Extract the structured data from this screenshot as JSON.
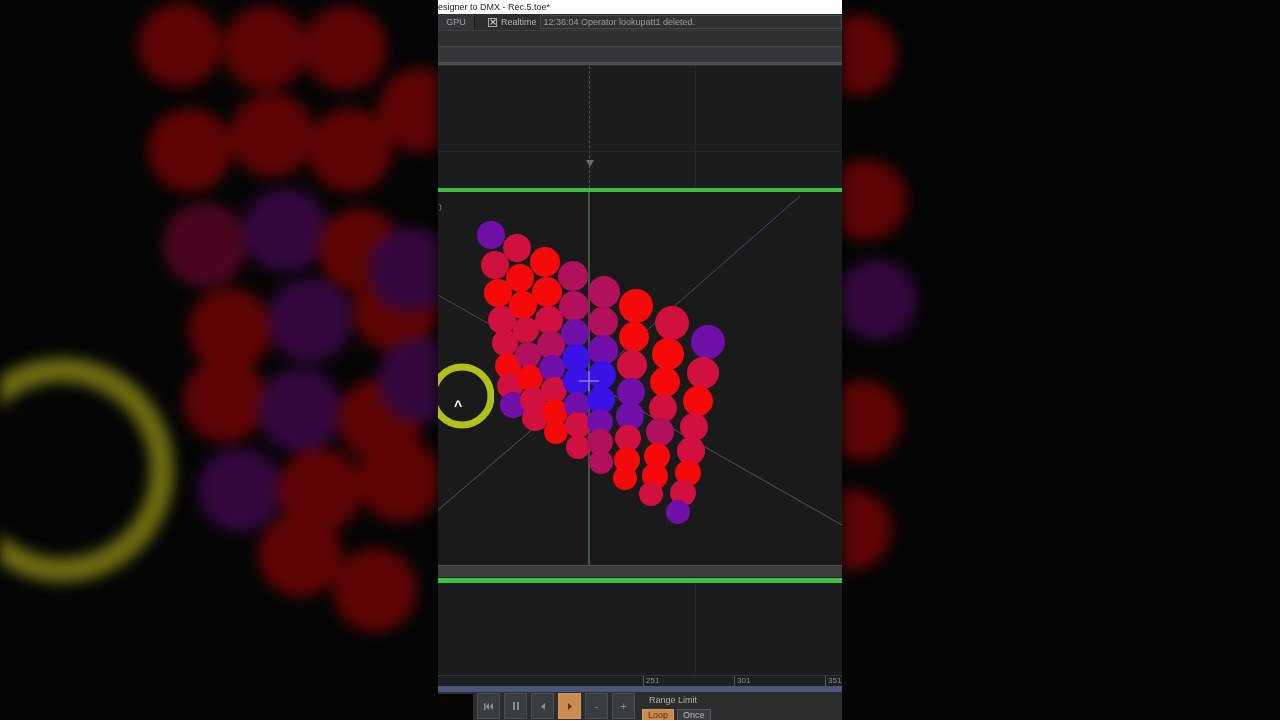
{
  "window": {
    "title": "esigner to DMX - Rec.5.toe*"
  },
  "toolbar": {
    "gpu_label": "GPU",
    "realtime": {
      "label": "Realtime",
      "checked": true
    },
    "message": "12:36:04 Operator lookupatt1 deleted."
  },
  "viewer": {
    "corner_text": ")",
    "ring_glyph": "^"
  },
  "timeline": {
    "ticks": [
      "251",
      "301",
      "351"
    ]
  },
  "transport": {
    "buttons": [
      {
        "kind": "skip-start",
        "selected": false
      },
      {
        "kind": "pause",
        "selected": false
      },
      {
        "kind": "step-back",
        "selected": false
      },
      {
        "kind": "play",
        "selected": true
      },
      {
        "kind": "minus",
        "label": "-",
        "selected": false
      },
      {
        "kind": "plus",
        "label": "+",
        "selected": false
      }
    ],
    "range_limit": {
      "label": "Range Limit",
      "options": [
        {
          "label": "Loop",
          "selected": true
        },
        {
          "label": "Once",
          "selected": false
        }
      ]
    }
  }
}
